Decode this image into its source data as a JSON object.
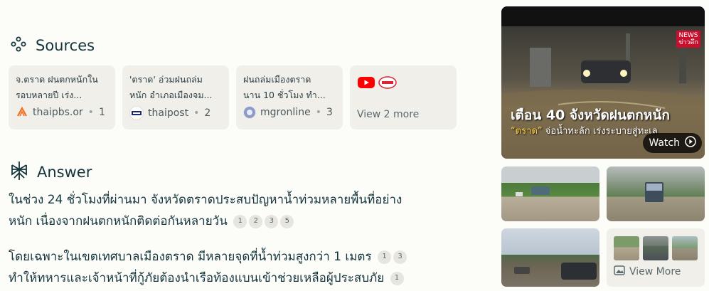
{
  "sources": {
    "heading": "Sources",
    "cards": [
      {
        "title_lines": [
          "จ.ตราด ฝนตกหนักใน",
          "รอบหลายปี เร่ง..."
        ],
        "site": "thaipbs.or",
        "index": "1"
      },
      {
        "title_lines": [
          "'ตราด' อ่วมฝนถล่ม",
          "หนัก อำเภอเมืองจม..."
        ],
        "site": "thaipost",
        "index": "2"
      },
      {
        "title_lines": [
          "ฝนถล่มเมืองตราด",
          "นาน 10 ชั่วโมง ทำ..."
        ],
        "site": "mgronline",
        "index": "3"
      }
    ],
    "more_label": "View 2 more"
  },
  "answer": {
    "heading": "Answer",
    "para1_line1": "ในช่วง 24 ชั่วโมงที่ผ่านมา จังหวัดตราดประสบปัญหาน้ำท่วมหลายพื้นที่อย่าง",
    "para1_line2": "หนัก เนื่องจากฝนตกหนักติดต่อกันหลายวัน",
    "para1_citations": [
      "1",
      "2",
      "3",
      "5"
    ],
    "para2_line1": "โดยเฉพาะในเขตเทศบาลเมืองตราด มีหลายจุดที่น้ำท่วมสูงกว่า 1 เมตร",
    "para2_line1_citations": [
      "1",
      "3"
    ],
    "para2_line2": "ทำให้ทหารและเจ้าหน้าที่กู้ภัยต้องนำเรือท้องแบนเข้าช่วยเหลือผู้ประสบภัย",
    "para2_line2_citations": [
      "1"
    ]
  },
  "media": {
    "video_logo": "ข่าวดึก",
    "video_headline": "เตือน 40 จังหวัดฝนตกหนัก",
    "video_sub_highlight": "“ตราด”",
    "video_sub_rest": " จ่อน้ำทะลัก เร่งระบายสู่ทะเล",
    "watch_label": "Watch",
    "view_more_label": "View More"
  },
  "colors": {
    "background": "#fcfcf9",
    "card_bg": "#f0efea",
    "text": "#13343b",
    "muted": "#5a6a6e",
    "youtube_red": "#ff0000",
    "video_highlight": "#ffd23f"
  },
  "icons": {
    "sources": "sources-icon",
    "answer": "answer-icon",
    "watch": "play-icon",
    "view_more": "image-icon"
  }
}
